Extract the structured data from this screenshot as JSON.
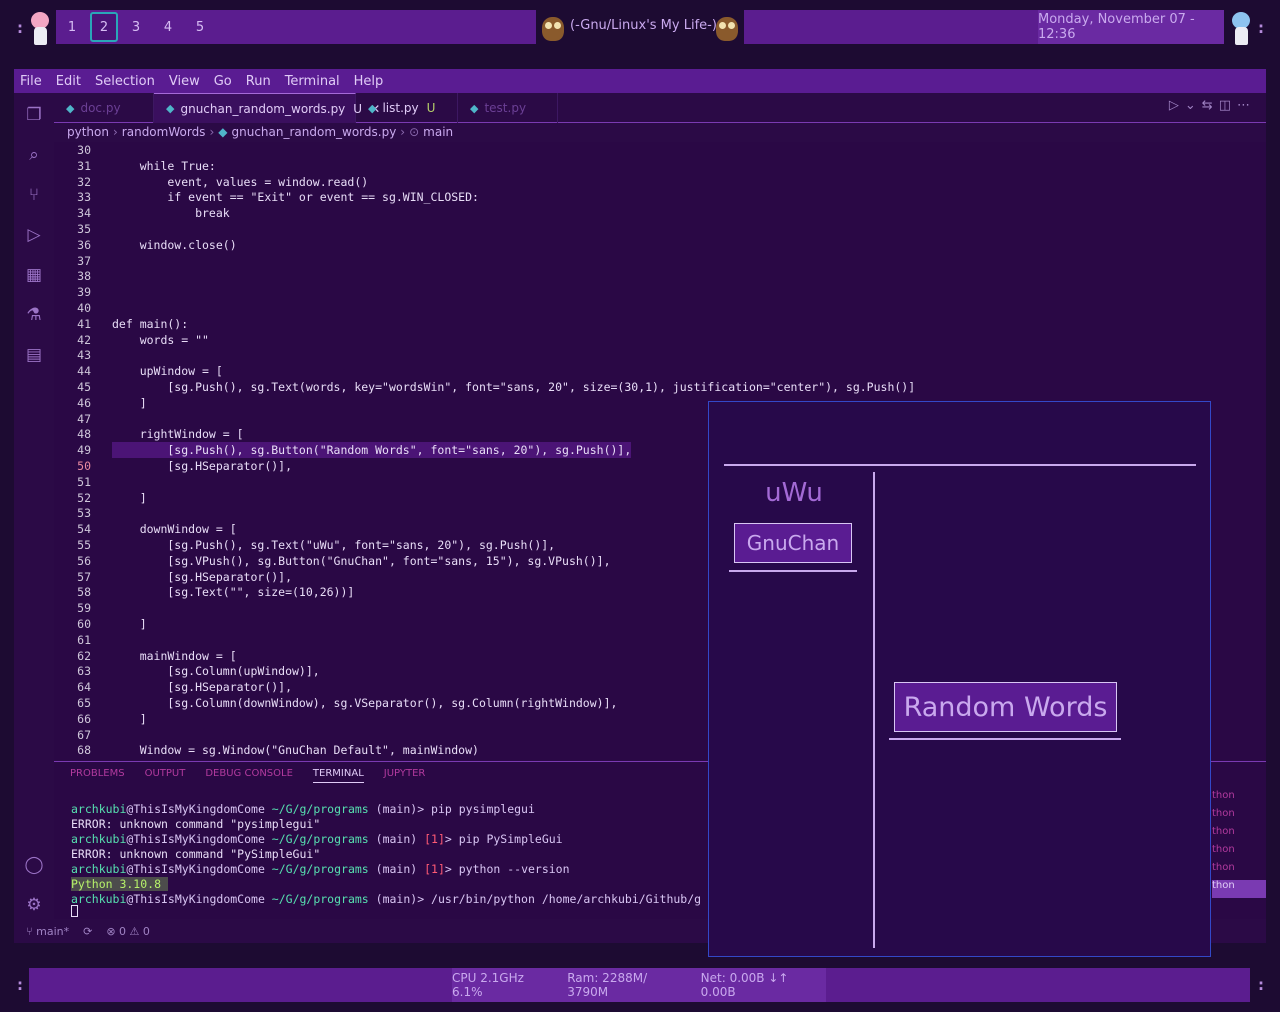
{
  "topbar": {
    "workspaces": [
      "1",
      "2",
      "3",
      "4",
      "5"
    ],
    "active_workspace": "2",
    "center_title": "(-Gnu/Linux's My Life-)",
    "clock": "Monday, November 07 - 12:36"
  },
  "menubar": [
    "File",
    "Edit",
    "Selection",
    "View",
    "Go",
    "Run",
    "Terminal",
    "Help"
  ],
  "activity_icons": [
    "files-icon",
    "search-icon",
    "source-control-icon",
    "run-debug-icon",
    "extensions-icon",
    "testing-icon",
    "notebook-icon",
    "account-icon",
    "settings-gear-icon"
  ],
  "tabs": [
    {
      "label": "doc.py",
      "modified": "",
      "active": false
    },
    {
      "label": "gnuchan_random_words.py",
      "modified": "U",
      "active": true
    },
    {
      "label": "list.py",
      "modified": "U",
      "active": false
    },
    {
      "label": "test.py",
      "modified": "",
      "active": false
    }
  ],
  "breadcrumb": [
    "python",
    "randomWords",
    "gnuchan_random_words.py",
    "main"
  ],
  "code_lines": [
    {
      "n": "30",
      "t": ""
    },
    {
      "n": "31",
      "t": "    while True:"
    },
    {
      "n": "32",
      "t": "        event, values = window.read()"
    },
    {
      "n": "33",
      "t": "        if event == \"Exit\" or event == sg.WIN_CLOSED:"
    },
    {
      "n": "34",
      "t": "            break"
    },
    {
      "n": "35",
      "t": ""
    },
    {
      "n": "36",
      "t": "    window.close()"
    },
    {
      "n": "37",
      "t": ""
    },
    {
      "n": "38",
      "t": ""
    },
    {
      "n": "39",
      "t": ""
    },
    {
      "n": "40",
      "t": ""
    },
    {
      "n": "41",
      "t": "def main():"
    },
    {
      "n": "42",
      "t": "    words = \"\""
    },
    {
      "n": "43",
      "t": ""
    },
    {
      "n": "44",
      "t": "    upWindow = ["
    },
    {
      "n": "45",
      "t": "        [sg.Push(), sg.Text(words, key=\"wordsWin\", font=\"sans, 20\", size=(30,1), justification=\"center\"), sg.Push()]"
    },
    {
      "n": "46",
      "t": "    ]"
    },
    {
      "n": "47",
      "t": ""
    },
    {
      "n": "48",
      "t": "    rightWindow = ["
    },
    {
      "n": "49",
      "t": "        [sg.Push(), sg.Button(\"Random Words\", font=\"sans, 20\"), sg.Push()],"
    },
    {
      "n": "50",
      "t": "        [sg.HSeparator()],"
    },
    {
      "n": "51",
      "t": ""
    },
    {
      "n": "52",
      "t": "    ]"
    },
    {
      "n": "53",
      "t": ""
    },
    {
      "n": "54",
      "t": "    downWindow = ["
    },
    {
      "n": "55",
      "t": "        [sg.Push(), sg.Text(\"uWu\", font=\"sans, 20\"), sg.Push()],"
    },
    {
      "n": "56",
      "t": "        [sg.VPush(), sg.Button(\"GnuChan\", font=\"sans, 15\"), sg.VPush()],"
    },
    {
      "n": "57",
      "t": "        [sg.HSeparator()],"
    },
    {
      "n": "58",
      "t": "        [sg.Text(\"\", size=(10,26))]"
    },
    {
      "n": "59",
      "t": ""
    },
    {
      "n": "60",
      "t": "    ]"
    },
    {
      "n": "61",
      "t": ""
    },
    {
      "n": "62",
      "t": "    mainWindow = ["
    },
    {
      "n": "63",
      "t": "        [sg.Column(upWindow)],"
    },
    {
      "n": "64",
      "t": "        [sg.HSeparator()],"
    },
    {
      "n": "65",
      "t": "        [sg.Column(downWindow), sg.VSeparator(), sg.Column(rightWindow)],"
    },
    {
      "n": "66",
      "t": "    ]"
    },
    {
      "n": "67",
      "t": ""
    },
    {
      "n": "68",
      "t": "    Window = sg.Window(\"GnuChan Default\", mainWindow)"
    }
  ],
  "current_line": "50",
  "panel_tabs": [
    "PROBLEMS",
    "OUTPUT",
    "DEBUG CONSOLE",
    "TERMINAL",
    "JUPYTER"
  ],
  "active_panel_tab": "TERMINAL",
  "terminal": [
    {
      "user": "archkubi",
      "host": "@ThisIsMyKingdomCome",
      "path": " ~/G/g/programs",
      "branch": " (main)",
      "code": "",
      "cmd": "> pip pysimplegui"
    },
    {
      "out": "ERROR: unknown command \"pysimplegui\""
    },
    {
      "user": "archkubi",
      "host": "@ThisIsMyKingdomCome",
      "path": " ~/G/g/programs",
      "branch": " (main)",
      "code": " [1]",
      "cmd": "> pip PySimpleGui"
    },
    {
      "out": "ERROR: unknown command \"PySimpleGui\""
    },
    {
      "user": "archkubi",
      "host": "@ThisIsMyKingdomCome",
      "path": " ~/G/g/programs",
      "branch": " (main)",
      "code": " [1]",
      "cmd": "> python --version"
    },
    {
      "out_hl": "Python 3.10.8 "
    },
    {
      "user": "archkubi",
      "host": "@ThisIsMyKingdomCome",
      "path": " ~/G/g/programs",
      "branch": " (main)",
      "code": "",
      "cmd": "> /usr/bin/python /home/archkubi/Github/g"
    }
  ],
  "terminal_side": [
    "thon",
    "thon",
    "thon",
    "thon",
    "thon",
    "thon"
  ],
  "statusbar": {
    "branch": "main*",
    "errors": "0",
    "warnings": "0"
  },
  "psg_window": {
    "text_uwu": "uWu",
    "button_gnuchan": "GnuChan",
    "button_random": "Random Words"
  },
  "bottombar": {
    "cpu": "CPU 2.1GHz 6.1%",
    "ram": "Ram:  2288M/ 3790M",
    "net": "Net:  0.00B ↓↑  0.00B"
  },
  "colors": {
    "bar_purple": "#5b1d8f",
    "bar_purple_light": "#6a2aa2",
    "editor_bg": "#2a0845",
    "accent_teal": "#2aa6b8"
  }
}
